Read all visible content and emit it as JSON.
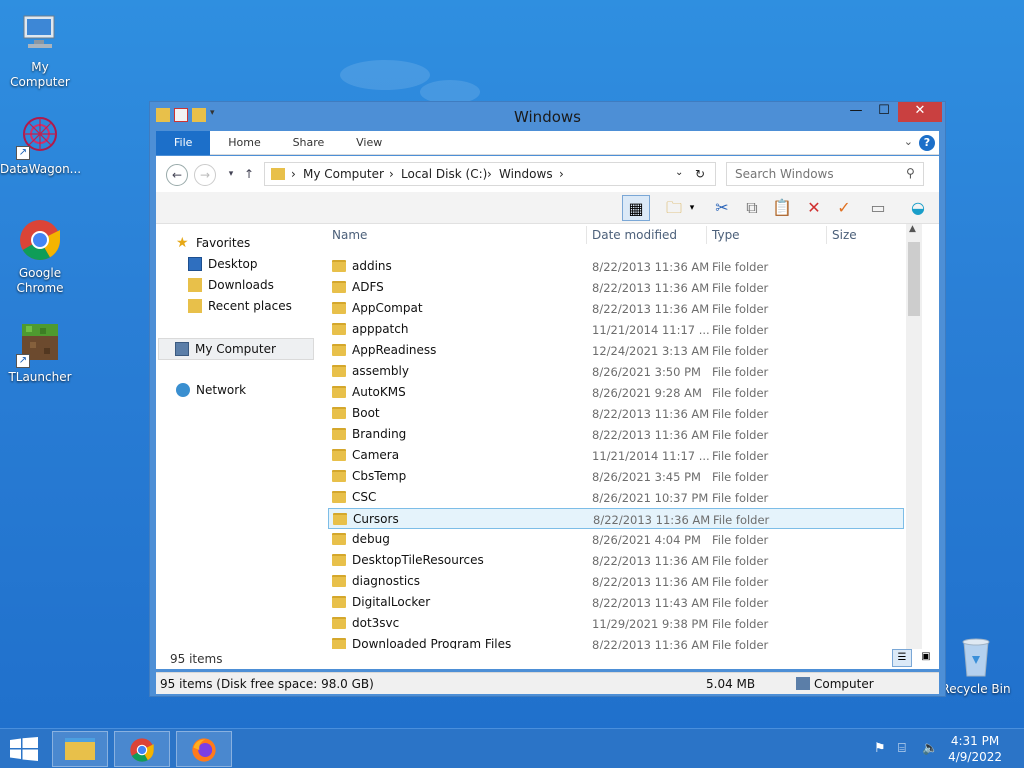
{
  "desktop": {
    "icons": [
      {
        "label": "My Computer",
        "icon": "computer-icon"
      },
      {
        "label": "DataWagon...",
        "icon": "datawagon-icon"
      },
      {
        "label": "Google Chrome",
        "icon": "chrome-icon"
      },
      {
        "label": "TLauncher",
        "icon": "tlauncher-icon"
      },
      {
        "label": "Recycle Bin",
        "icon": "recycle-bin-icon"
      }
    ]
  },
  "window": {
    "title": "Windows",
    "ribbon_tabs": [
      "File",
      "Home",
      "Share",
      "View"
    ],
    "address": {
      "crumbs": [
        "My Computer",
        "Local Disk (C:)",
        "Windows"
      ]
    },
    "search_placeholder": "Search Windows",
    "navigation": {
      "favorites": "Favorites",
      "favorite_items": [
        "Desktop",
        "Downloads",
        "Recent places"
      ],
      "my_computer": "My Computer",
      "network": "Network"
    },
    "columns": [
      "Name",
      "Date modified",
      "Type",
      "Size"
    ],
    "files": [
      {
        "name": "addins",
        "date": "8/22/2013 11:36 AM",
        "type": "File folder"
      },
      {
        "name": "ADFS",
        "date": "8/22/2013 11:36 AM",
        "type": "File folder"
      },
      {
        "name": "AppCompat",
        "date": "8/22/2013 11:36 AM",
        "type": "File folder"
      },
      {
        "name": "apppatch",
        "date": "11/21/2014 11:17 ...",
        "type": "File folder"
      },
      {
        "name": "AppReadiness",
        "date": "12/24/2021 3:13 AM",
        "type": "File folder"
      },
      {
        "name": "assembly",
        "date": "8/26/2021 3:50 PM",
        "type": "File folder"
      },
      {
        "name": "AutoKMS",
        "date": "8/26/2021 9:28 AM",
        "type": "File folder"
      },
      {
        "name": "Boot",
        "date": "8/22/2013 11:36 AM",
        "type": "File folder"
      },
      {
        "name": "Branding",
        "date": "8/22/2013 11:36 AM",
        "type": "File folder"
      },
      {
        "name": "Camera",
        "date": "11/21/2014 11:17 ...",
        "type": "File folder"
      },
      {
        "name": "CbsTemp",
        "date": "8/26/2021 3:45 PM",
        "type": "File folder"
      },
      {
        "name": "CSC",
        "date": "8/26/2021 10:37 PM",
        "type": "File folder"
      },
      {
        "name": "Cursors",
        "date": "8/22/2013 11:36 AM",
        "type": "File folder",
        "selected": true
      },
      {
        "name": "debug",
        "date": "8/26/2021 4:04 PM",
        "type": "File folder"
      },
      {
        "name": "DesktopTileResources",
        "date": "8/22/2013 11:36 AM",
        "type": "File folder"
      },
      {
        "name": "diagnostics",
        "date": "8/22/2013 11:36 AM",
        "type": "File folder"
      },
      {
        "name": "DigitalLocker",
        "date": "8/22/2013 11:43 AM",
        "type": "File folder"
      },
      {
        "name": "dot3svc",
        "date": "11/29/2021 9:38 PM",
        "type": "File folder"
      },
      {
        "name": "Downloaded Program Files",
        "date": "8/22/2013 11:36 AM",
        "type": "File folder"
      }
    ],
    "item_count": "95 items",
    "status": {
      "summary": "95 items (Disk free space: 98.0 GB)",
      "size": "5.04 MB",
      "location": "Computer"
    }
  },
  "taskbar": {
    "apps": [
      "file-explorer-icon",
      "chrome-icon",
      "firefox-icon"
    ],
    "time": "4:31 PM",
    "date": "4/9/2022"
  },
  "colors": {
    "accent": "#1c6fc9",
    "folder": "#e8c04a",
    "selection": "#e5f3fb"
  }
}
